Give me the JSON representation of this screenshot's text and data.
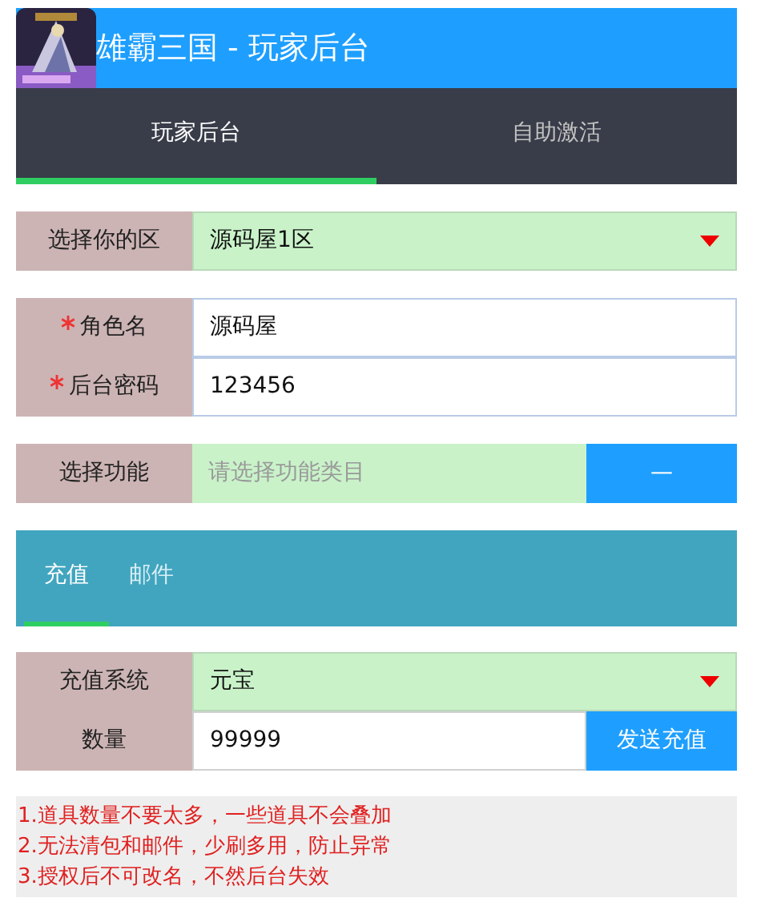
{
  "header": {
    "title": "雄霸三国 - 玩家后台"
  },
  "nav_tabs": [
    {
      "label": "玩家后台",
      "selected": true
    },
    {
      "label": "自助激活",
      "selected": false
    }
  ],
  "server_select": {
    "label": "选择你的区",
    "value": "源码屋1区"
  },
  "account_fields": [
    {
      "label": "角色名",
      "required": true,
      "value": "源码屋"
    },
    {
      "label": "后台密码",
      "required": true,
      "value": "123456"
    }
  ],
  "function_select": {
    "label": "选择功能",
    "placeholder": "请选择功能类目",
    "button": "—"
  },
  "panel_tabs": [
    {
      "label": "充值",
      "selected": true
    },
    {
      "label": "邮件",
      "selected": false
    }
  ],
  "recharge_system": {
    "label": "充值系统",
    "value": "元宝"
  },
  "quantity": {
    "label": "数量",
    "value": "99999",
    "button": "发送充值"
  },
  "notes": [
    "1.道具数量不要太多，一些道具不会叠加",
    "2.无法清包和邮件，少刷多用，防止异常",
    "3.授权后不可改名，不然后台失效"
  ]
}
